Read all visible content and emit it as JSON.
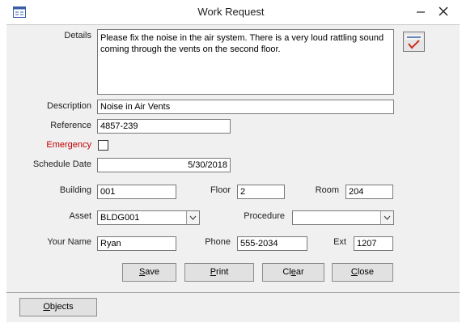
{
  "window": {
    "title": "Work Request"
  },
  "labels": {
    "details": "Details",
    "description": "Description",
    "reference": "Reference",
    "emergency": "Emergency",
    "schedule_date": "Schedule Date",
    "building": "Building",
    "floor": "Floor",
    "room": "Room",
    "asset": "Asset",
    "procedure": "Procedure",
    "your_name": "Your Name",
    "phone": "Phone",
    "ext": "Ext"
  },
  "fields": {
    "details": "Please fix the noise in the air system. There is a very loud rattling sound coming through the vents on the second floor.",
    "description": "Noise in Air Vents",
    "reference": "4857-239",
    "emergency_checked": false,
    "schedule_date": "5/30/2018",
    "building": "001",
    "floor": "2",
    "room": "204",
    "asset": "BLDG001",
    "procedure": "",
    "your_name": "Ryan",
    "phone": "555-2034",
    "ext": "1207"
  },
  "buttons": {
    "save": {
      "first": "S",
      "rest": "ave"
    },
    "print": {
      "first": "P",
      "rest": "rint"
    },
    "clear": {
      "pre": "Cl",
      "key": "e",
      "post": "ar"
    },
    "close": {
      "first": "C",
      "rest": "lose"
    },
    "objects": {
      "first": "O",
      "rest": "bjects"
    }
  },
  "spell_check": {
    "label": "Spell Check",
    "icon": "spell-check-icon"
  }
}
